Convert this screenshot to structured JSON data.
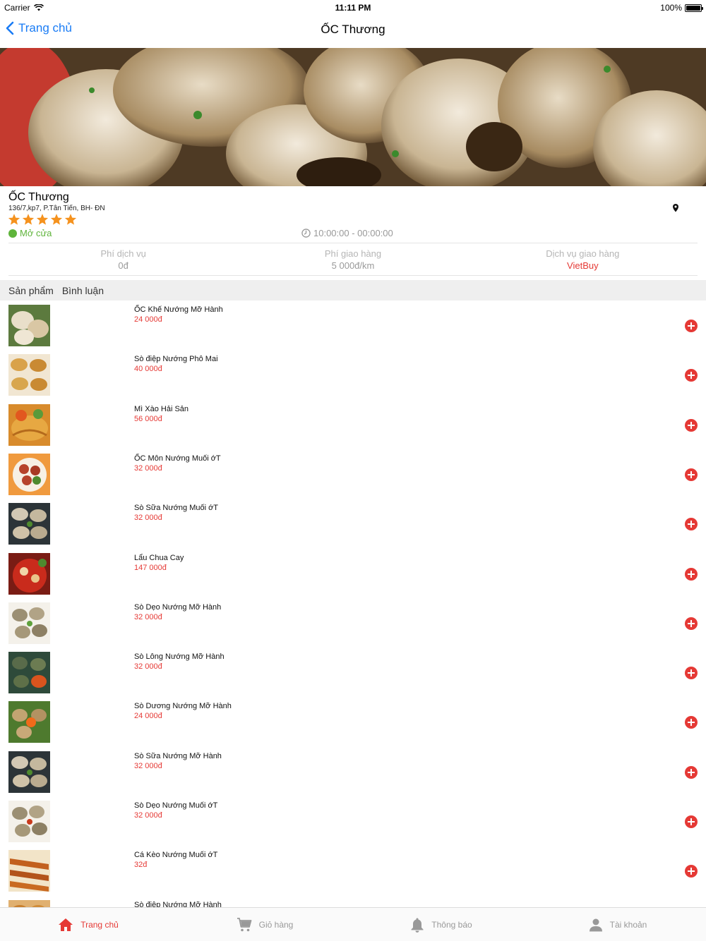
{
  "status_bar": {
    "carrier": "Carrier",
    "time": "11:11 PM",
    "battery": "100%"
  },
  "nav": {
    "back_label": "Trang chủ",
    "title": "ỐC Thương"
  },
  "shop": {
    "name": "ỐC Thương",
    "address": "136/7,kp7, P.Tân Tiến, BH- ĐN",
    "rating": 5,
    "open_status": "Mở cửa",
    "hours": "10:00:00 - 00:00:00"
  },
  "fees": {
    "service_label": "Phí dịch vụ",
    "service_value": "0đ",
    "delivery_label": "Phí giao hàng",
    "delivery_value": "5 000đ/km",
    "provider_label": "Dịch vụ giao hàng",
    "provider_value": "VietBuy"
  },
  "tabs": {
    "products": "Sản phẩm",
    "reviews": "Bình luận"
  },
  "products": [
    {
      "name": "ỐC Khế Nướng Mỡ Hành",
      "price": "24 000đ"
    },
    {
      "name": "Sò điệp Nướng Phô Mai",
      "price": "40 000đ"
    },
    {
      "name": "Mì Xào Hải Sản",
      "price": "56 000đ"
    },
    {
      "name": "ỐC Môn Nướng Muối ớT",
      "price": "32 000đ"
    },
    {
      "name": "Sò Sữa Nướng Muối ớT",
      "price": "32 000đ"
    },
    {
      "name": "Lẩu Chua Cay",
      "price": "147 000đ"
    },
    {
      "name": "Sò Dẹo Nướng Mỡ Hành",
      "price": "32 000đ"
    },
    {
      "name": "Sò Lông Nướng Mỡ Hành",
      "price": "32 000đ"
    },
    {
      "name": "Sò Dương Nướng Mỡ Hành",
      "price": "24 000đ"
    },
    {
      "name": "Sò Sữa Nướng Mỡ Hành",
      "price": "32 000đ"
    },
    {
      "name": "Sò Dẹo Nướng Muối ớT",
      "price": "32 000đ"
    },
    {
      "name": "Cá Kèo Nướng Muối ớT",
      "price": "32đ"
    },
    {
      "name": "Sò điệp Nướng Mỡ Hành",
      "price": ""
    }
  ],
  "tab_bar": {
    "home": "Trang chủ",
    "cart": "Giỏ hàng",
    "notifications": "Thông báo",
    "account": "Tài khoản"
  },
  "colors": {
    "accent": "#e53935",
    "link": "#1a7cf5",
    "open": "#5fb43b",
    "star": "#f5921e"
  }
}
